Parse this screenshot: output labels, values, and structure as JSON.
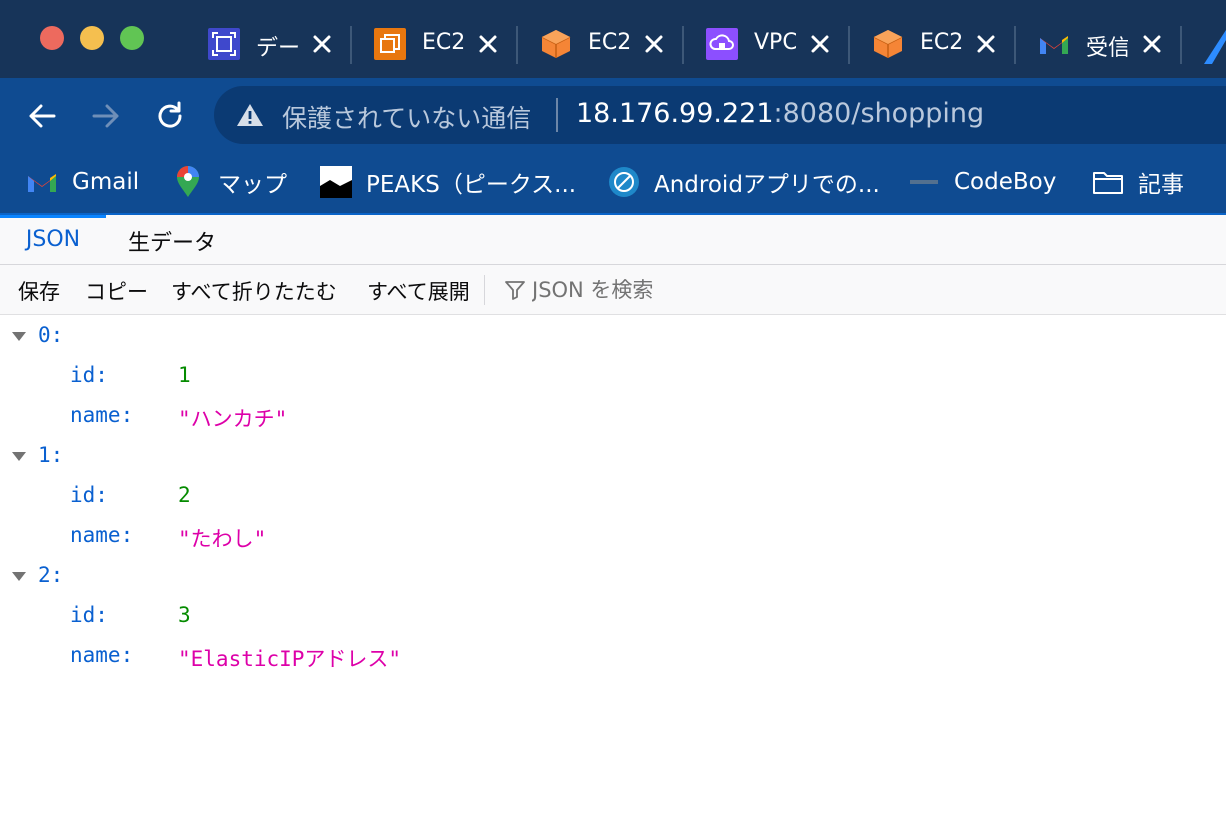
{
  "window": {
    "traffic_lights": [
      "close",
      "minimize",
      "zoom"
    ]
  },
  "tabs": [
    {
      "title": "データ",
      "icon": "aws-service-icon",
      "color": "#3f48cc"
    },
    {
      "title": "EC2",
      "icon": "aws-ec2-instances-icon",
      "color": "#e8770f"
    },
    {
      "title": "EC2",
      "icon": "ec2-cube-icon",
      "color": "#f58536"
    },
    {
      "title": "VPC",
      "icon": "aws-vpc-icon",
      "color": "#8c4fff"
    },
    {
      "title": "EC2",
      "icon": "ec2-cube-icon",
      "color": "#f58536"
    },
    {
      "title": "受信",
      "icon": "gmail-icon",
      "color": "#ea4335"
    }
  ],
  "toolbar": {
    "security_label": "保護されていない通信",
    "url_host": "18.176.99.221",
    "url_rest": ":8080/shopping"
  },
  "bookmarks": [
    {
      "label": "Gmail",
      "icon": "gmail-icon"
    },
    {
      "label": "マップ",
      "icon": "maps-pin-icon"
    },
    {
      "label": "PEAKS（ピークス...",
      "icon": "peaks-logo-icon"
    },
    {
      "label": "Androidアプリでの...",
      "icon": "compass-icon"
    },
    {
      "label": "CodeBoy",
      "icon": "codeboy-logo-icon"
    },
    {
      "label": "記事",
      "icon": "folder-icon"
    }
  ],
  "viewer": {
    "tabs": {
      "json": "JSON",
      "raw": "生データ"
    },
    "buttons": {
      "save": "保存",
      "copy": "コピー",
      "collapse_all": "すべて折りたたむ",
      "expand_all": "すべて展開"
    },
    "filter_placeholder": "JSON を検索"
  },
  "json_items": [
    {
      "index": "0:",
      "id_key": "id:",
      "id": "1",
      "name_key": "name:",
      "name": "\"ハンカチ\""
    },
    {
      "index": "1:",
      "id_key": "id:",
      "id": "2",
      "name_key": "name:",
      "name": "\"たわし\""
    },
    {
      "index": "2:",
      "id_key": "id:",
      "id": "3",
      "name_key": "name:",
      "name": "\"ElasticIPアドレス\""
    }
  ],
  "colors": {
    "tabstrip": "#173459",
    "toolbar": "#0f4b91",
    "json_key": "#0a60d0",
    "json_number": "#058b00",
    "json_string": "#dd00a9"
  }
}
